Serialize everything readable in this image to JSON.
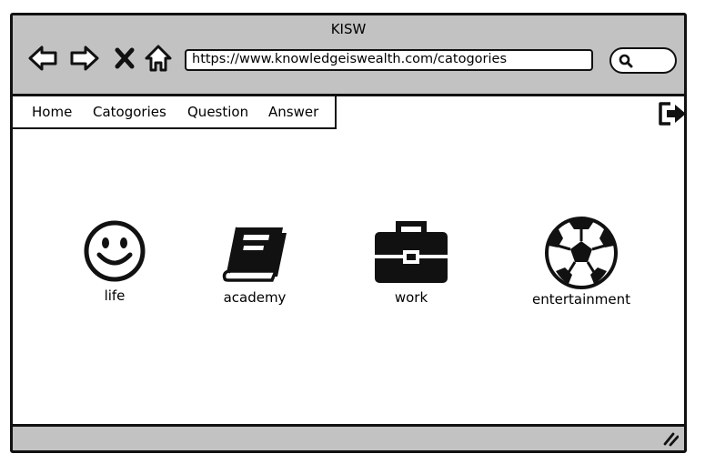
{
  "window": {
    "title": "KISW"
  },
  "browser": {
    "url": "https://www.knowledgeiswealth.com/catogories",
    "icons": {
      "back": "back-arrow-icon",
      "forward": "forward-arrow-icon",
      "close": "close-x-icon",
      "home": "home-icon",
      "search": "search-icon"
    }
  },
  "menu": {
    "items": [
      {
        "label": "Home"
      },
      {
        "label": "Catogories"
      },
      {
        "label": "Question"
      },
      {
        "label": "Answer"
      }
    ]
  },
  "logout": {
    "icon": "sign-out-icon"
  },
  "categories": [
    {
      "label": "life",
      "icon": "smiley-icon"
    },
    {
      "label": "academy",
      "icon": "book-icon"
    },
    {
      "label": "work",
      "icon": "briefcase-icon"
    },
    {
      "label": "entertainment",
      "icon": "soccer-ball-icon"
    }
  ],
  "colors": {
    "chrome": "#c2c2c2",
    "stroke": "#111111",
    "background": "#ffffff"
  }
}
